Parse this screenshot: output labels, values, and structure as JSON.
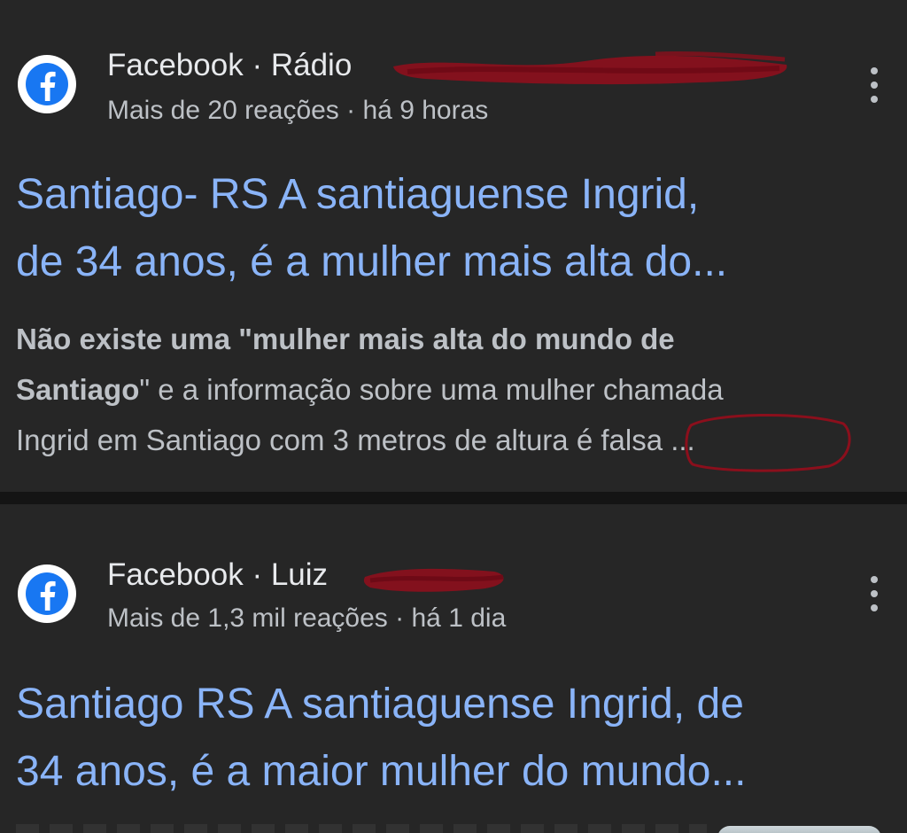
{
  "results": [
    {
      "source": "Facebook",
      "separator": "·",
      "author_visible": "Rádio",
      "reactions": "Mais de 20 reações",
      "time": "há 9 horas",
      "title_line1": "Santiago- RS A santiaguense Ingrid,",
      "title_line2": "de 34 anos, é a mulher mais alta do...",
      "snippet_bold1": "Não existe uma \"mulher mais alta do mundo de",
      "snippet_bold2": "Santiago",
      "snippet_rest1": "\" e a informação sobre uma mulher chamada",
      "snippet_line3_a": "Ingrid em Santiago com 3 metros de altura",
      "snippet_line3_b": " é falsa ..."
    },
    {
      "source": "Facebook",
      "separator": "·",
      "author_visible": "Luiz",
      "reactions": "Mais de 1,3 mil reações",
      "time": "há 1 dia",
      "title_line1": "Santiago RS A santiaguense Ingrid, de",
      "title_line2": "34 anos, é a maior mulher do mundo..."
    }
  ],
  "icons": {
    "logo": "facebook-logo-icon",
    "menu": "more-vertical-icon"
  },
  "colors": {
    "background": "#202124",
    "card": "#262626",
    "title_link": "#8ab4f8",
    "text_primary": "#e8eaed",
    "text_secondary": "#bdc1c6",
    "facebook_blue": "#1877f2",
    "redaction": "#8b0f1c"
  }
}
